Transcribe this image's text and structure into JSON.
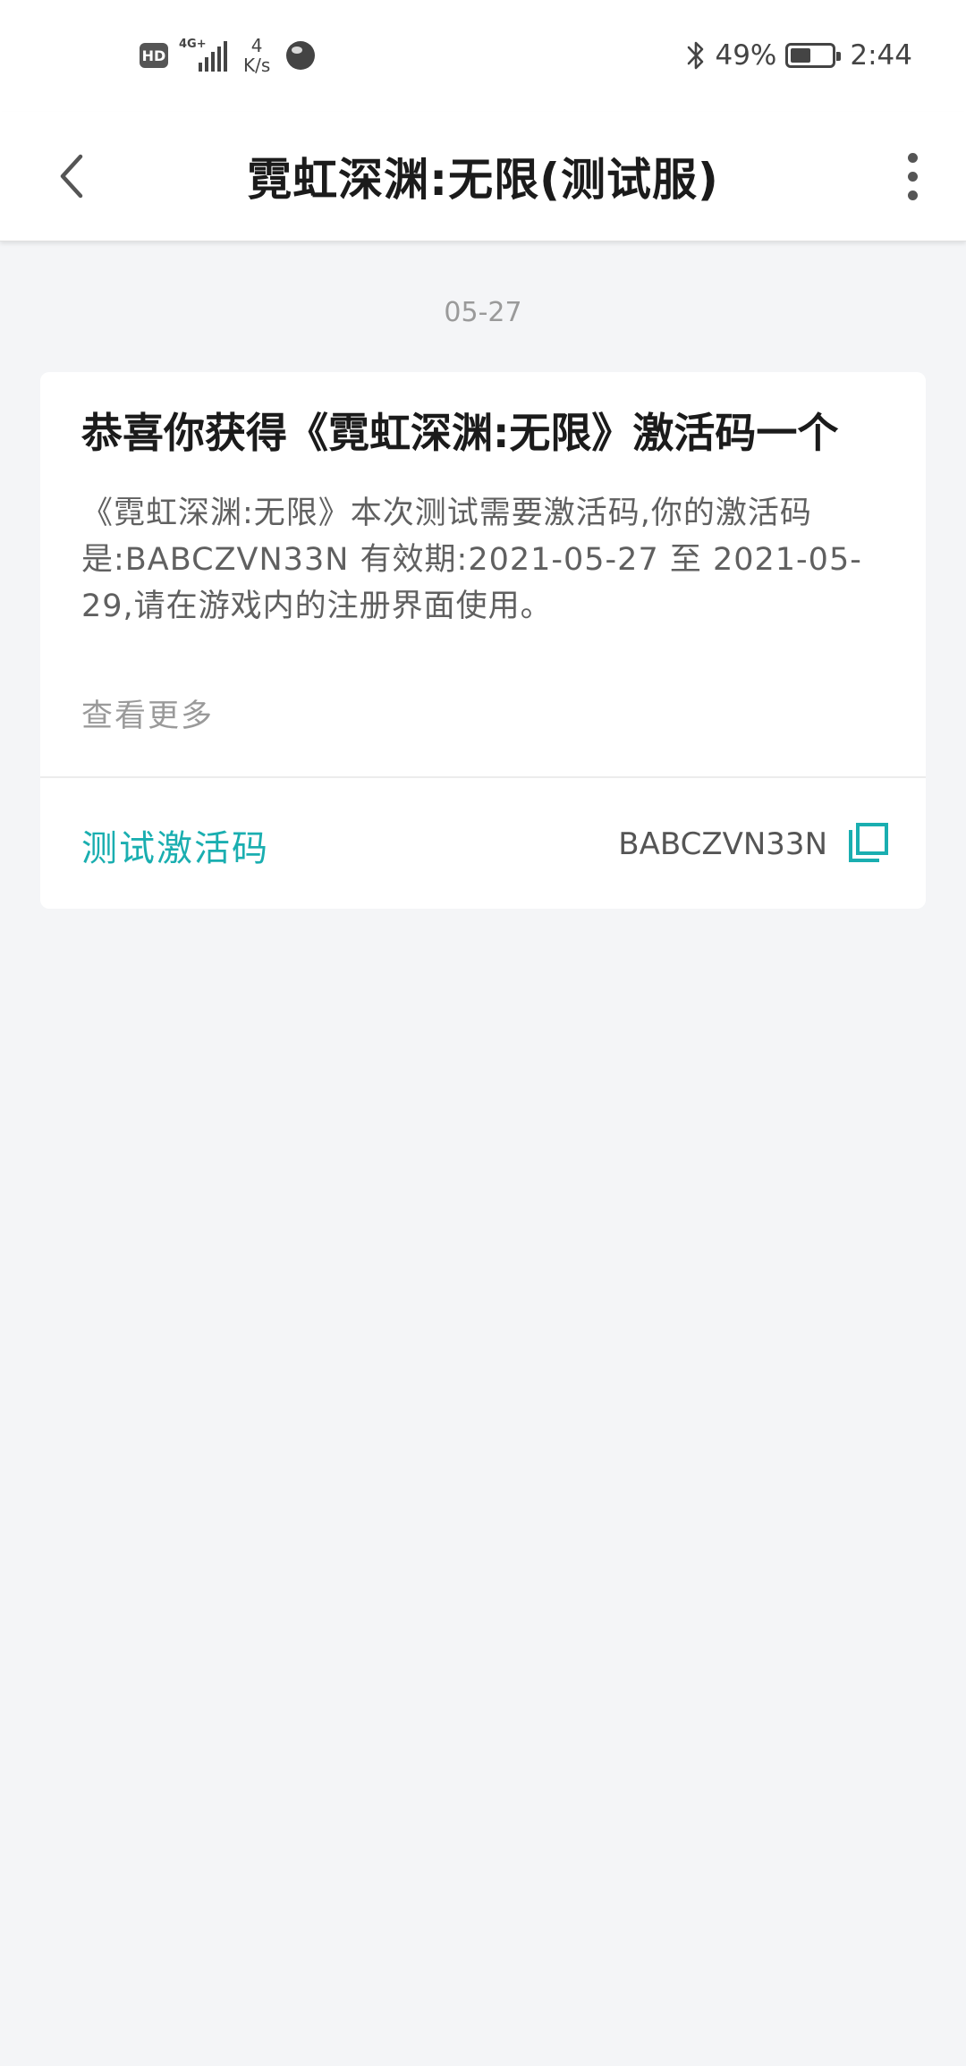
{
  "status_bar": {
    "hd_badge": "HD",
    "network_type": "4G+",
    "net_speed_value": "4",
    "net_speed_unit": "K/s",
    "battery_percent": "49%",
    "battery_level": 0.49,
    "time": "2:44",
    "icons": [
      "hd-icon",
      "signal-icon",
      "globe-icon",
      "bluetooth-icon",
      "battery-icon"
    ]
  },
  "header": {
    "title": "霓虹深渊:无限(测试服)",
    "icons": [
      "back-arrow-icon",
      "more-vertical-icon"
    ]
  },
  "message": {
    "date": "05-27",
    "title": "恭喜你获得《霓虹深渊:无限》激活码一个",
    "body": "《霓虹深渊:无限》本次测试需要激活码,你的激活码是:BABCZVN33N 有效期:2021-05-27 至 2021-05-29,请在游戏内的注册界面使用。",
    "view_more": "查看更多",
    "code_label": "测试激活码",
    "code_value": "BABCZVN33N"
  },
  "colors": {
    "accent": "#1aaeb0",
    "background": "#f4f5f7",
    "card": "#ffffff"
  }
}
